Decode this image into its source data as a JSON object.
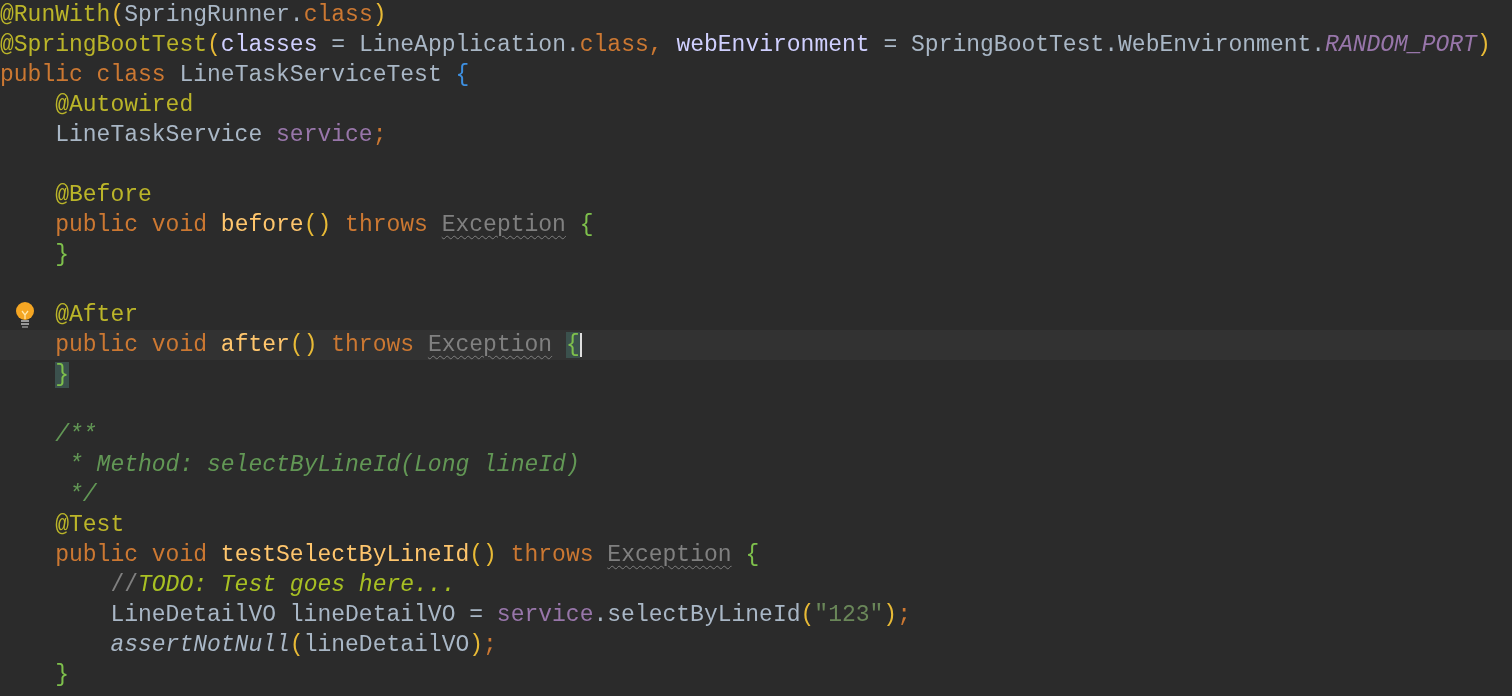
{
  "editor": {
    "blocks": [
      {
        "lines": [
          {
            "tokens": [
              {
                "text": "@RunWith",
                "kind": "annotation"
              },
              {
                "text": "(",
                "kind": "paren"
              },
              {
                "text": "SpringRunner.",
                "kind": "plain"
              },
              {
                "text": "class",
                "kind": "keyword"
              },
              {
                "text": ")",
                "kind": "paren"
              }
            ]
          },
          {
            "tokens": [
              {
                "text": "@SpringBootTest",
                "kind": "annotation"
              },
              {
                "text": "(",
                "kind": "paren"
              },
              {
                "text": "classes",
                "kind": "param"
              },
              {
                "text": " = LineApplication.",
                "kind": "plain"
              },
              {
                "text": "class",
                "kind": "keyword"
              },
              {
                "text": ", ",
                "kind": "keyword"
              },
              {
                "text": "webEnvironment",
                "kind": "param"
              },
              {
                "text": " = SpringBootTest.WebEnvironment.",
                "kind": "plain"
              },
              {
                "text": "RANDOM_PORT",
                "kind": "constant"
              },
              {
                "text": ")",
                "kind": "paren"
              }
            ]
          },
          {
            "tokens": [
              {
                "text": "public class ",
                "kind": "keyword"
              },
              {
                "text": "LineTaskServiceTest ",
                "kind": "plain"
              },
              {
                "text": "{",
                "kind": "brace-outer"
              }
            ]
          },
          {
            "tokens": [
              {
                "text": "    @Autowired",
                "kind": "annotation"
              }
            ]
          },
          {
            "tokens": [
              {
                "text": "    LineTaskService ",
                "kind": "plain"
              },
              {
                "text": "service",
                "kind": "field"
              },
              {
                "text": ";",
                "kind": "keyword"
              }
            ]
          }
        ]
      },
      {
        "lines": [
          {
            "tokens": [
              {
                "text": "    @Before",
                "kind": "annotation"
              }
            ]
          },
          {
            "tokens": [
              {
                "text": "    public void ",
                "kind": "keyword"
              },
              {
                "text": "before",
                "kind": "method"
              },
              {
                "text": "() ",
                "kind": "paren"
              },
              {
                "text": "throws ",
                "kind": "keyword"
              },
              {
                "text": "Exception",
                "kind": "unused"
              },
              {
                "text": " {",
                "kind": "brace"
              }
            ]
          },
          {
            "tokens": [
              {
                "text": "    }",
                "kind": "brace"
              }
            ]
          }
        ]
      },
      {
        "lines": [
          {
            "lightbulb": true,
            "tokens": [
              {
                "text": "    @After",
                "kind": "annotation"
              }
            ]
          },
          {
            "current": true,
            "caret": true,
            "tokens": [
              {
                "text": "    public void ",
                "kind": "keyword"
              },
              {
                "text": "after",
                "kind": "method"
              },
              {
                "text": "() ",
                "kind": "paren"
              },
              {
                "text": "throws ",
                "kind": "keyword"
              },
              {
                "text": "Exception",
                "kind": "unused"
              },
              {
                "text": " {",
                "kind": "brace",
                "matched": true
              }
            ]
          },
          {
            "tokens": [
              {
                "text": "    }",
                "kind": "brace",
                "matched": true
              }
            ]
          }
        ]
      },
      {
        "lines": [
          {
            "tokens": [
              {
                "text": "    /**",
                "kind": "doc"
              }
            ]
          },
          {
            "tokens": [
              {
                "text": "     * Method: selectByLineId(Long lineId)",
                "kind": "doc"
              }
            ]
          },
          {
            "tokens": [
              {
                "text": "     */",
                "kind": "doc"
              }
            ]
          },
          {
            "tokens": [
              {
                "text": "    @Test",
                "kind": "annotation"
              }
            ]
          },
          {
            "tokens": [
              {
                "text": "    public void ",
                "kind": "keyword"
              },
              {
                "text": "testSelectByLineId",
                "kind": "method"
              },
              {
                "text": "() ",
                "kind": "paren"
              },
              {
                "text": "throws ",
                "kind": "keyword"
              },
              {
                "text": "Exception",
                "kind": "unused"
              },
              {
                "text": " {",
                "kind": "brace"
              }
            ]
          },
          {
            "tokens": [
              {
                "text": "        //",
                "kind": "comment"
              },
              {
                "text": "TODO: Test goes here...",
                "kind": "todo"
              }
            ]
          },
          {
            "tokens": [
              {
                "text": "        LineDetailVO lineDetailVO = ",
                "kind": "plain"
              },
              {
                "text": "service",
                "kind": "field"
              },
              {
                "text": ".selectByLineId",
                "kind": "plain"
              },
              {
                "text": "(",
                "kind": "paren"
              },
              {
                "text": "\"123\"",
                "kind": "string"
              },
              {
                "text": ")",
                "kind": "paren"
              },
              {
                "text": ";",
                "kind": "keyword"
              }
            ]
          },
          {
            "tokens": [
              {
                "text": "        assertNotNull",
                "kind": "static"
              },
              {
                "text": "(",
                "kind": "paren"
              },
              {
                "text": "lineDetailVO",
                "kind": "plain"
              },
              {
                "text": ")",
                "kind": "paren"
              },
              {
                "text": ";",
                "kind": "keyword"
              }
            ]
          },
          {
            "tokens": [
              {
                "text": "    }",
                "kind": "brace"
              }
            ]
          }
        ]
      }
    ]
  }
}
